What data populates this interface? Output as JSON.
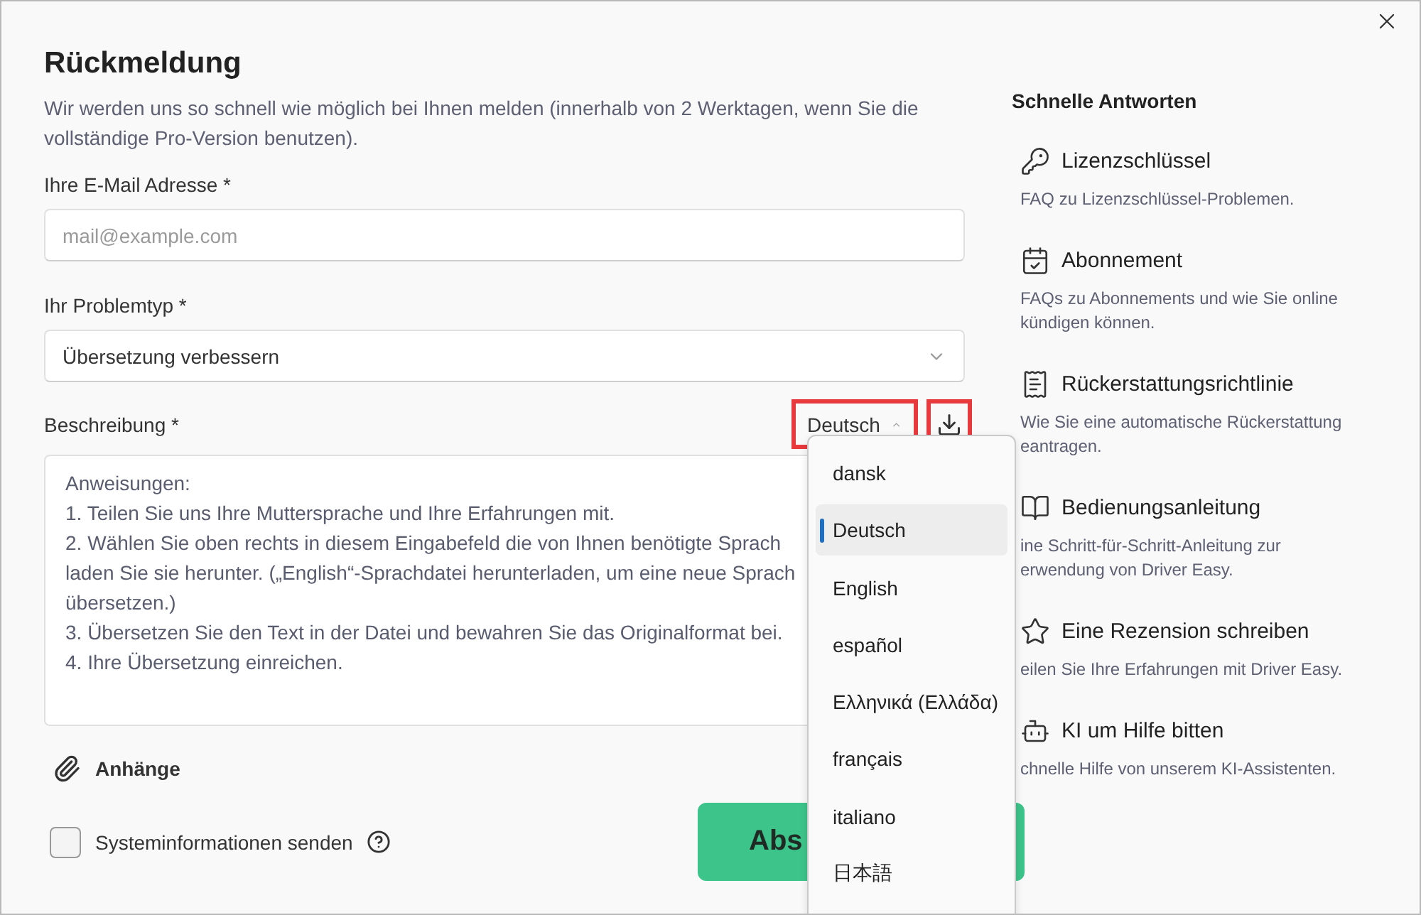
{
  "title": "Rückmeldung",
  "intro": "Wir werden uns so schnell wie möglich bei Ihnen melden (innerhalb von 2 Werktagen, wenn Sie die vollständige Pro-Version benutzen).",
  "email": {
    "label": "Ihre E-Mail Adresse *",
    "placeholder": "mail@example.com"
  },
  "problem_type": {
    "label": "Ihr Problemtyp *",
    "value": "Übersetzung verbessern"
  },
  "description": {
    "label": "Beschreibung *",
    "language": "Deutsch",
    "lines": [
      "Anweisungen:",
      "1. Teilen Sie uns Ihre Muttersprache und Ihre Erfahrungen mit.",
      "2. Wählen Sie oben rechts in diesem Eingabefeld die von Ihnen benötigte Sprach",
      "laden Sie sie herunter. („English“-Sprachdatei herunterladen, um eine neue Sprach",
      "übersetzen.)",
      "3. Übersetzen Sie den Text in der Datei und bewahren Sie das Originalformat bei.",
      "4. Ihre Übersetzung einreichen."
    ]
  },
  "attachments": "Anhänge",
  "system_info": {
    "label": "Systeminformationen senden",
    "checked": false
  },
  "submit": "Abs",
  "quick_answers": {
    "title": "Schnelle Antworten",
    "items": [
      {
        "title": "Lizenzschlüssel",
        "lines": [
          "FAQ zu Lizenzschlüssel-Problemen."
        ]
      },
      {
        "title": "Abonnement",
        "lines": [
          "FAQs zu Abonnements und wie Sie online",
          "kündigen können."
        ]
      },
      {
        "title": "Rückerstattungsrichtlinie",
        "lines": [
          "Wie Sie eine automatische Rückerstattung",
          "eantragen."
        ]
      },
      {
        "title": "Bedienungsanleitung",
        "lines": [
          "ine Schritt-für-Schritt-Anleitung zur",
          "erwendung von Driver Easy."
        ]
      },
      {
        "title": "Eine Rezension schreiben",
        "lines": [
          "eilen Sie Ihre Erfahrungen mit Driver Easy."
        ]
      },
      {
        "title": "KI um Hilfe bitten",
        "lines": [
          "chnelle Hilfe von unserem KI-Assistenten."
        ]
      }
    ]
  },
  "language_menu": [
    {
      "label": "dansk",
      "selected": false
    },
    {
      "label": "Deutsch",
      "selected": true
    },
    {
      "label": "English",
      "selected": false
    },
    {
      "label": "español",
      "selected": false
    },
    {
      "label": "Ελληνικά (Ελλάδα)",
      "selected": false
    },
    {
      "label": "français",
      "selected": false
    },
    {
      "label": "italiano",
      "selected": false
    },
    {
      "label": "日本語",
      "selected": false
    }
  ]
}
